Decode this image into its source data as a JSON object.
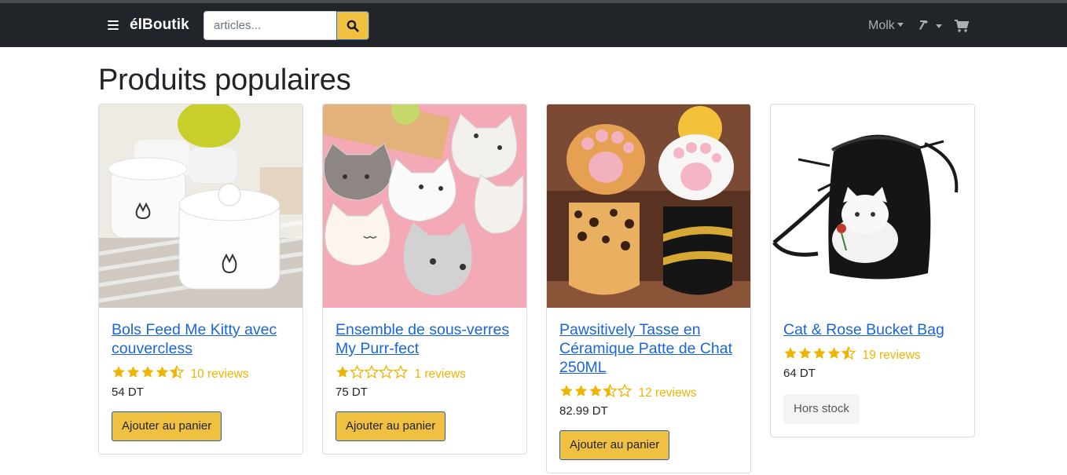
{
  "nav": {
    "brand": "élBoutik",
    "search_placeholder": "articles...",
    "user_label": "Molk"
  },
  "page_title": "Produits populaires",
  "products": [
    {
      "title": "Bols Feed Me Kitty avec couvercless",
      "rating": 4.5,
      "reviews": "10 reviews",
      "price": "54 DT",
      "action": "Ajouter au panier"
    },
    {
      "title": "Ensemble de sous-verres My Purr-fect",
      "rating": 1,
      "reviews": "1 reviews",
      "price": "75 DT",
      "action": "Ajouter au panier"
    },
    {
      "title": "Pawsitively Tasse en Céramique Patte de Chat 250ML",
      "rating": 3.5,
      "reviews": "12 reviews",
      "price": "82.99 DT",
      "action": "Ajouter au panier"
    },
    {
      "title": "Cat & Rose Bucket Bag",
      "rating": 4.5,
      "reviews": "19 reviews",
      "price": "64 DT",
      "action": "Hors stock"
    }
  ],
  "colors": {
    "navbar": "#212529",
    "accent": "#f0c040",
    "link": "#1a66d6",
    "star": "#f0b400"
  }
}
